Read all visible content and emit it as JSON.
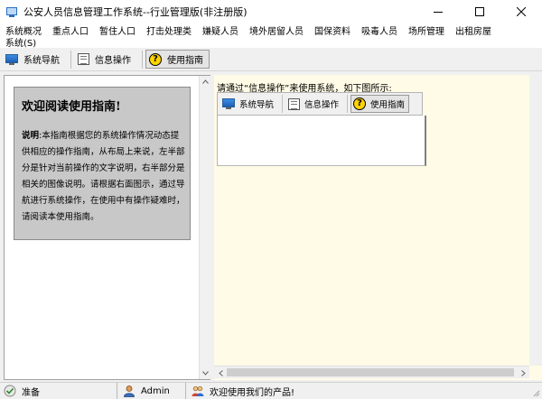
{
  "window": {
    "title": "公安人员信息管理工作系统--行业管理版(非注册版)"
  },
  "menu": {
    "row1": [
      "系统概况",
      "重点人口",
      "暂住人口",
      "打击处理类",
      "嫌疑人员",
      "境外居留人员",
      "国保资料",
      "吸毒人员",
      "场所管理",
      "出租房屋"
    ],
    "row2": [
      "系统(S)"
    ]
  },
  "toolbar": {
    "items": [
      {
        "label": "系统导航",
        "icon": "monitor-icon"
      },
      {
        "label": "信息操作",
        "icon": "info-icon"
      },
      {
        "label": "使用指南",
        "icon": "help-icon"
      }
    ],
    "active": "使用指南"
  },
  "guide": {
    "title": "欢迎阅读使用指南!",
    "desc_label": "说明",
    "desc_text": ":本指南根据您的系统操作情况动态提供相应的操作指南，从布局上来说，左半部分是针对当前操作的文字说明，右半部分是相关的图像说明。请根据右面图示，通过导航进行系统操作，在使用中有操作疑难时，请阅读本使用指南。"
  },
  "preview": {
    "caption": "请通过“信息操作”来使用系统，如下图所示:",
    "items": [
      {
        "label": "系统导航",
        "icon": "monitor-icon"
      },
      {
        "label": "信息操作",
        "icon": "info-icon"
      },
      {
        "label": "使用指南",
        "icon": "help-icon"
      }
    ]
  },
  "status": {
    "state": "准备",
    "user": "Admin",
    "message": "欢迎使用我们的产品!"
  },
  "colors": {
    "right_bg": "#fffbe6",
    "guide_box": "#c8c8c8",
    "help_icon": "#ffd400"
  }
}
